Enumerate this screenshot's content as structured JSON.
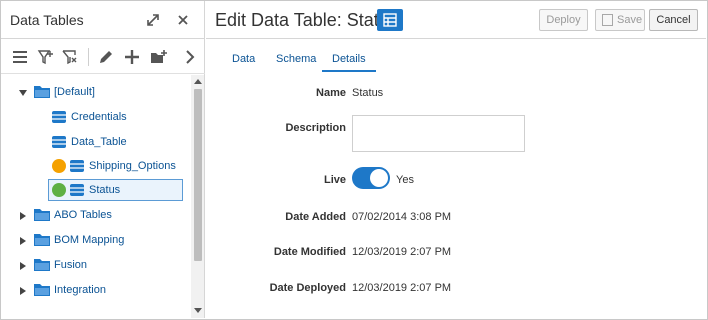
{
  "left_panel": {
    "title": "Data Tables",
    "tree": [
      {
        "label": "[Default]",
        "kind": "folder",
        "expanded": true
      },
      {
        "label": "Credentials",
        "kind": "table"
      },
      {
        "label": "Data_Table",
        "kind": "table"
      },
      {
        "label": "Shipping_Options",
        "kind": "table",
        "status": "orange"
      },
      {
        "label": "Status",
        "kind": "table",
        "status": "green",
        "selected": true
      },
      {
        "label": "ABO Tables",
        "kind": "folder",
        "expanded": false
      },
      {
        "label": "BOM Mapping",
        "kind": "folder",
        "expanded": false
      },
      {
        "label": "Fusion",
        "kind": "folder",
        "expanded": false
      },
      {
        "label": "Integration",
        "kind": "folder",
        "expanded": false
      }
    ]
  },
  "editor": {
    "title": "Edit Data Table: Status",
    "buttons": {
      "deploy": "Deploy",
      "save": "Save",
      "cancel": "Cancel"
    },
    "tabs": [
      "Data",
      "Schema",
      "Details"
    ],
    "active_tab": "Details",
    "details": {
      "name_label": "Name",
      "name_value": "Status",
      "description_label": "Description",
      "description_value": "",
      "live_label": "Live",
      "live_value": "Yes",
      "date_added_label": "Date Added",
      "date_added_value": "07/02/2014 3:08 PM",
      "date_modified_label": "Date Modified",
      "date_modified_value": "12/03/2019 2:07 PM",
      "date_deployed_label": "Date Deployed",
      "date_deployed_value": "12/03/2019 2:07 PM"
    }
  },
  "colors": {
    "accent": "#1e78c8",
    "link": "#0b5394",
    "status_orange": "#f5a100",
    "status_green": "#5fb043"
  }
}
